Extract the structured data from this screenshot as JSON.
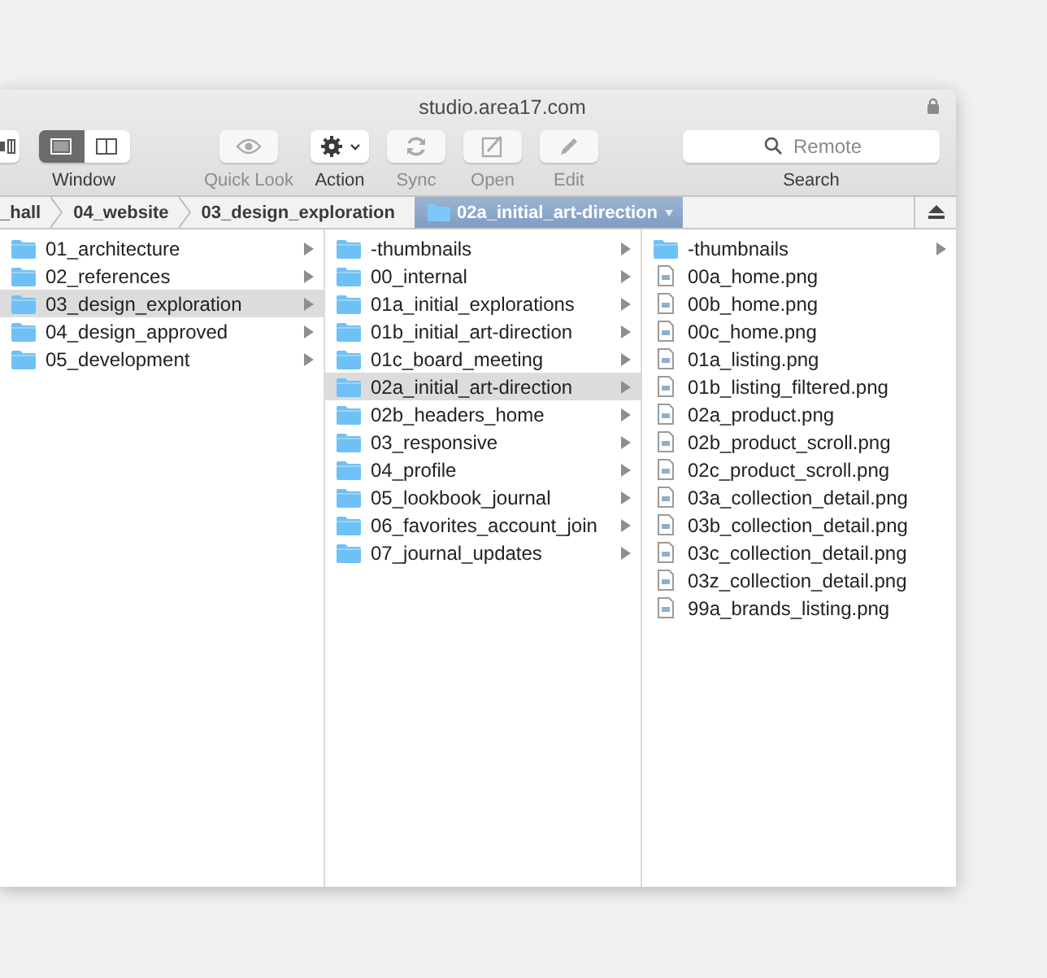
{
  "window": {
    "title": "studio.area17.com"
  },
  "toolbar": {
    "view_group": {
      "label": "Window",
      "segments": [
        {
          "selected": true
        },
        {
          "selected": false
        }
      ]
    },
    "buttons": [
      {
        "label": "Quick Look",
        "kind": "eye",
        "disabled": true
      },
      {
        "label": "Action",
        "kind": "gear",
        "disabled": false
      },
      {
        "label": "Sync",
        "kind": "sync",
        "disabled": true
      },
      {
        "label": "Open",
        "kind": "open",
        "disabled": true
      },
      {
        "label": "Edit",
        "kind": "pencil",
        "disabled": true
      }
    ],
    "search": {
      "placeholder": "Remote",
      "label": "Search"
    }
  },
  "path_bar": [
    {
      "label": "_hall",
      "selected": false
    },
    {
      "label": "04_website",
      "selected": false
    },
    {
      "label": "03_design_exploration",
      "selected": false
    },
    {
      "label": "02a_initial_art-direction",
      "selected": true
    }
  ],
  "columns": [
    {
      "items": [
        {
          "name": "01_architecture",
          "kind": "folder",
          "selected": false
        },
        {
          "name": "02_references",
          "kind": "folder",
          "selected": false
        },
        {
          "name": "03_design_exploration",
          "kind": "folder",
          "selected": true
        },
        {
          "name": "04_design_approved",
          "kind": "folder",
          "selected": false
        },
        {
          "name": "05_development",
          "kind": "folder",
          "selected": false
        }
      ]
    },
    {
      "items": [
        {
          "name": "-thumbnails",
          "kind": "folder",
          "selected": false
        },
        {
          "name": "00_internal",
          "kind": "folder",
          "selected": false
        },
        {
          "name": "01a_initial_explorations",
          "kind": "folder",
          "selected": false
        },
        {
          "name": "01b_initial_art-direction",
          "kind": "folder",
          "selected": false
        },
        {
          "name": "01c_board_meeting",
          "kind": "folder",
          "selected": false
        },
        {
          "name": "02a_initial_art-direction",
          "kind": "folder",
          "selected": true
        },
        {
          "name": "02b_headers_home",
          "kind": "folder",
          "selected": false
        },
        {
          "name": "03_responsive",
          "kind": "folder",
          "selected": false
        },
        {
          "name": "04_profile",
          "kind": "folder",
          "selected": false
        },
        {
          "name": "05_lookbook_journal",
          "kind": "folder",
          "selected": false
        },
        {
          "name": "06_favorites_account_join",
          "kind": "folder",
          "selected": false
        },
        {
          "name": "07_journal_updates",
          "kind": "folder",
          "selected": false
        }
      ]
    },
    {
      "items": [
        {
          "name": "-thumbnails",
          "kind": "folder",
          "selected": false
        },
        {
          "name": "00a_home.png",
          "kind": "file",
          "selected": false
        },
        {
          "name": "00b_home.png",
          "kind": "file",
          "selected": false
        },
        {
          "name": "00c_home.png",
          "kind": "file",
          "selected": false
        },
        {
          "name": "01a_listing.png",
          "kind": "file",
          "selected": false
        },
        {
          "name": "01b_listing_filtered.png",
          "kind": "file",
          "selected": false
        },
        {
          "name": "02a_product.png",
          "kind": "file",
          "selected": false
        },
        {
          "name": "02b_product_scroll.png",
          "kind": "file",
          "selected": false
        },
        {
          "name": "02c_product_scroll.png",
          "kind": "file",
          "selected": false
        },
        {
          "name": "03a_collection_detail.png",
          "kind": "file",
          "selected": false
        },
        {
          "name": "03b_collection_detail.png",
          "kind": "file",
          "selected": false
        },
        {
          "name": "03c_collection_detail.png",
          "kind": "file",
          "selected": false
        },
        {
          "name": "03z_collection_detail.png",
          "kind": "file",
          "selected": false
        },
        {
          "name": "99a_brands_listing.png",
          "kind": "file",
          "selected": false
        }
      ]
    }
  ]
}
